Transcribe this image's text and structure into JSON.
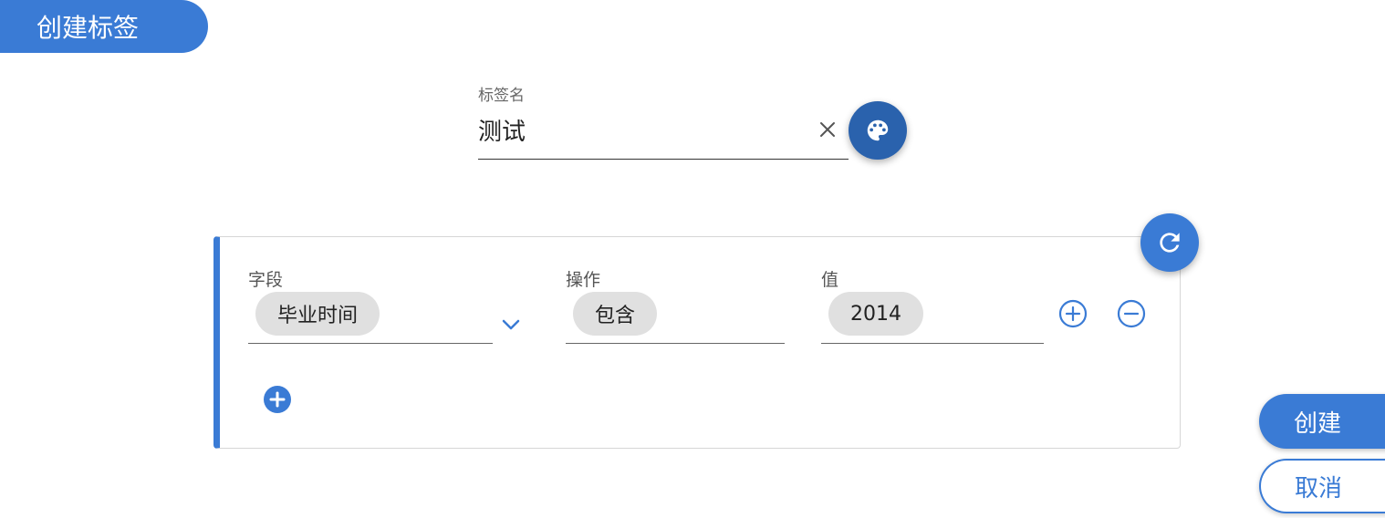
{
  "dialog": {
    "title": "创建标签"
  },
  "tag_name": {
    "label": "标签名",
    "value": "测试"
  },
  "condition": {
    "field": {
      "label": "字段",
      "value": "毕业时间"
    },
    "operation": {
      "label": "操作",
      "value": "包含"
    },
    "value": {
      "label": "值",
      "value": "2014"
    }
  },
  "actions": {
    "create_label": "创建",
    "cancel_label": "取消"
  },
  "colors": {
    "primary": "#3a7bd5",
    "primary_dark": "#2a62ad",
    "chip_bg": "#e0e0e0"
  },
  "icons": {
    "clear": "close-icon",
    "palette": "palette-icon",
    "refresh": "refresh-icon",
    "dropdown": "chevron-down-icon",
    "add_value": "add-circle-outline-icon",
    "remove_value": "remove-circle-outline-icon",
    "add_condition": "add-circle-icon"
  }
}
